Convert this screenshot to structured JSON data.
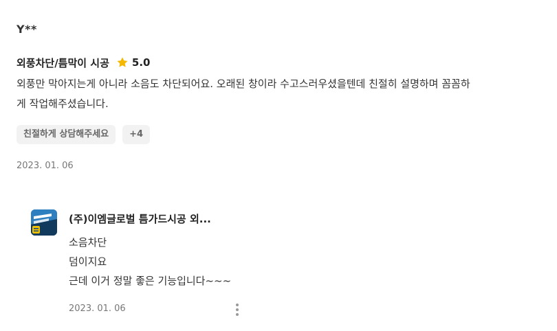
{
  "review": {
    "reviewer": "Y**",
    "service": "외풍차단/틈막이 시공",
    "star_icon": "star-icon",
    "star_color": "#F5B800",
    "rating": "5.0",
    "body": "외풍만 막아지는게 아니라 소음도 차단되어요. 오래된 창이라 수고스러우셨을텐데 친절히 설명하며 꼼꼼하\n게 작업해주셨습니다.",
    "tags": [
      "친절하게 상담해주세요",
      "+4"
    ],
    "date": "2023. 01. 06"
  },
  "reply": {
    "avatar_icon": "company-logo-icon",
    "company": "(주)이엠글로벌 틈가드시공 외...",
    "lines": [
      "소음차단",
      "덤이지요",
      "근데 이거 정말 좋은 기능입니다~~~"
    ],
    "date": "2023. 01. 06",
    "more_icon": "more-vertical-icon"
  }
}
